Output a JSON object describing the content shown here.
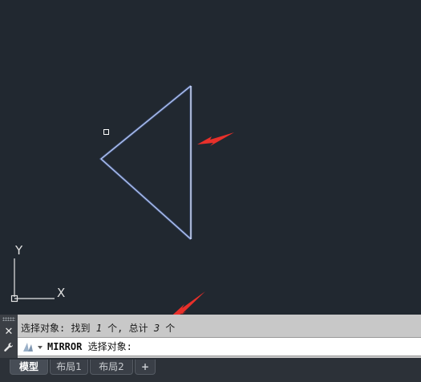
{
  "viewport": {
    "background": "#212830",
    "triangle_color": "#9fb7f5",
    "annotation_color": "#e8302a",
    "ucs": {
      "y_label": "Y",
      "x_label": "X"
    }
  },
  "command_line": {
    "history": {
      "prefix": "选择对象: 找到 ",
      "found_count": "1",
      "middle": " 个, 总计 ",
      "total_count": "3",
      "suffix": " 个"
    },
    "current_command": "MIRROR",
    "current_prompt": " 选择对象:",
    "close_icon": "close-icon",
    "customize_icon": "wrench-icon",
    "recent_icon": "recent-commands-icon"
  },
  "layout_tabs": {
    "tabs": [
      {
        "label": "模型",
        "active": true
      },
      {
        "label": "布局1",
        "active": false
      },
      {
        "label": "布局2",
        "active": false
      }
    ],
    "add_label": "+"
  }
}
